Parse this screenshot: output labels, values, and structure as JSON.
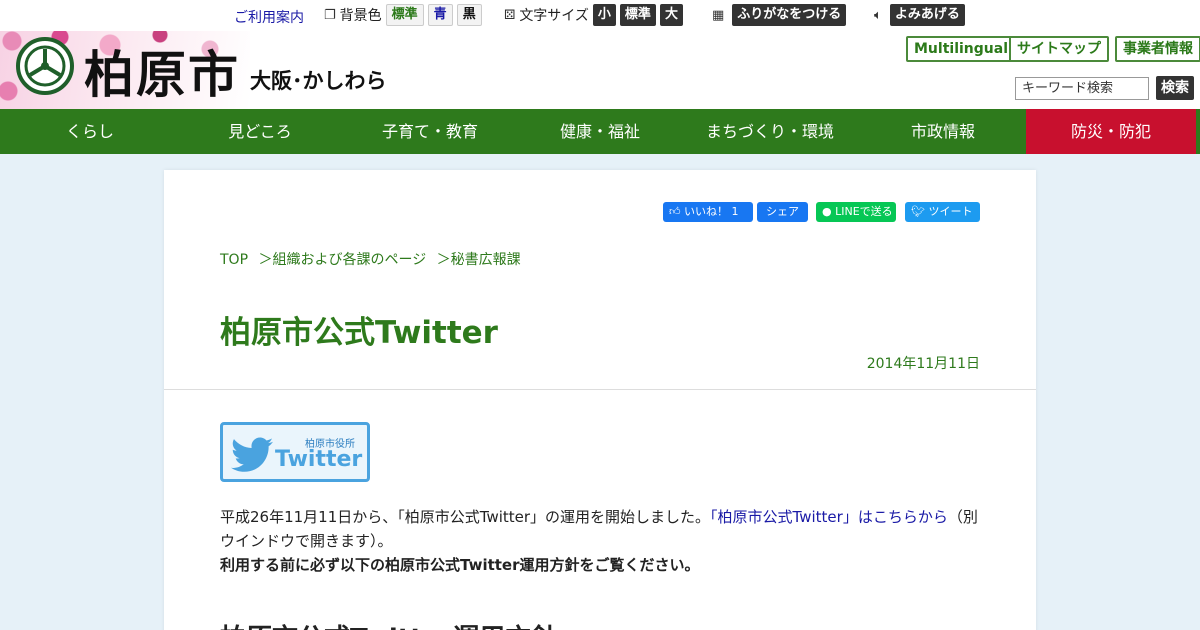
{
  "utility": {
    "guide_link": "ご利用案内",
    "bgcolor_label": "背景色",
    "bgcolor_options": [
      "標準",
      "青",
      "黒"
    ],
    "fontsize_label": "文字サイズ",
    "fontsize_options": [
      "小",
      "標準",
      "大"
    ],
    "furigana_button": "ふりがなをつける",
    "readaloud_button": "よみあげる"
  },
  "header": {
    "logo_text": "柏原市",
    "logo_sub": "大阪･かしわら",
    "buttons": [
      "Multilingual",
      "サイトマップ",
      "事業者情報"
    ],
    "search_placeholder": "キーワード検索",
    "search_button": "検索"
  },
  "nav": {
    "items": [
      "くらし",
      "見どころ",
      "子育て・教育",
      "健康・福祉",
      "まちづくり・環境",
      "市政情報",
      "防災・防犯"
    ]
  },
  "share": {
    "like": "いいね！ 1",
    "share": "シェア",
    "line": "LINEで送る",
    "tweet": "ツイート"
  },
  "breadcrumb": [
    "TOP",
    "＞組織および各課のページ",
    "＞秘書広報課"
  ],
  "page": {
    "title": "柏原市公式Twitter",
    "date": "2014年11月11日",
    "banner_office": "柏原市役所",
    "banner_word": "Twitter",
    "para_text1": "平成26年11月11日から、「柏原市公式Twitter」の運用を開始しました。",
    "para_link": "「柏原市公式Twitter」はこちらから",
    "para_text2": "（別ウインドウで開きます）。",
    "para_bold": "利用する前に必ず以下の柏原市公式Twitter運用方針をご覧ください。",
    "section_heading": "柏原市公式Twitter運用方針"
  },
  "colors": {
    "brand_green": "#2e7a1c",
    "disaster_red": "#c8102e",
    "page_bg": "#e6f1f8"
  }
}
